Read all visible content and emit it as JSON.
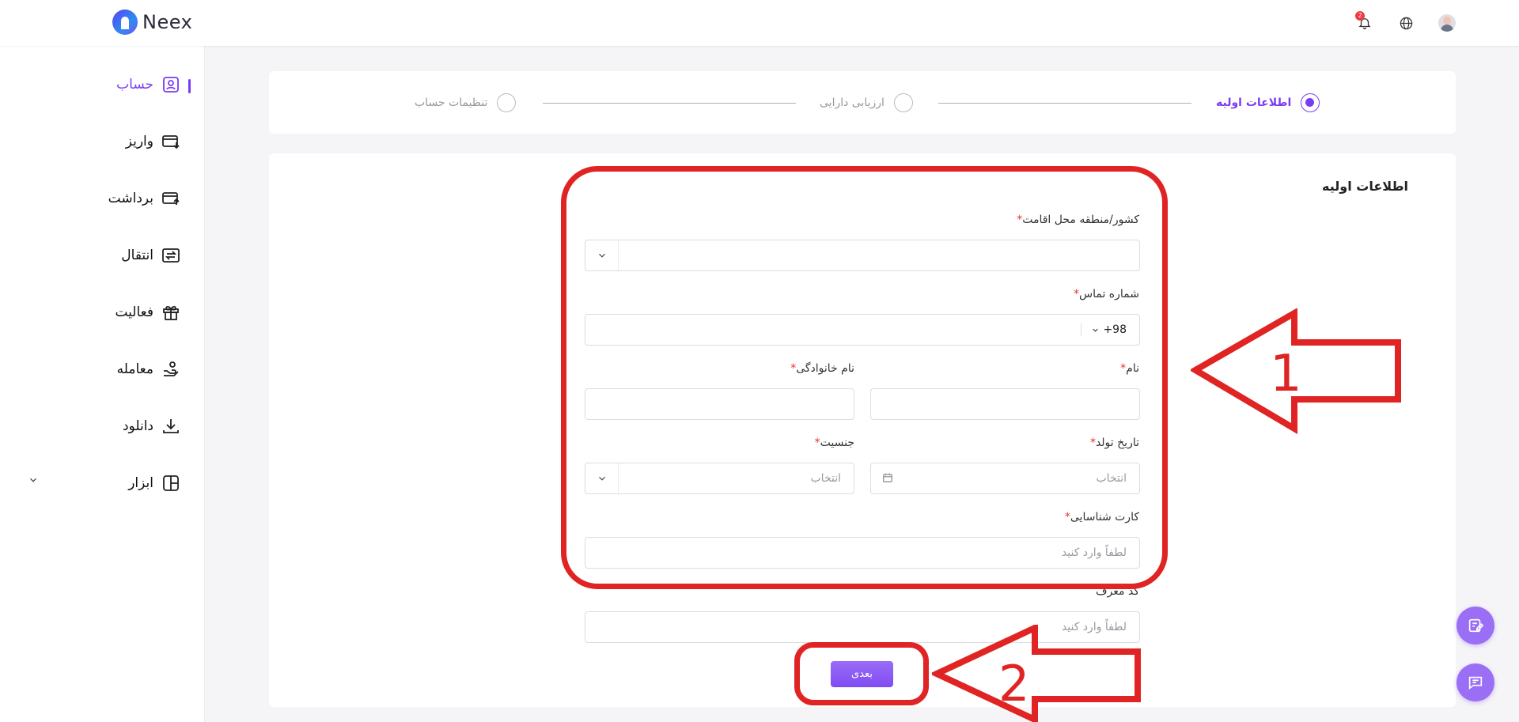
{
  "header": {
    "brand": "Neex",
    "notification_count": "2"
  },
  "sidebar": {
    "items": [
      {
        "label": "حساب",
        "icon": "user-square-icon",
        "active": true
      },
      {
        "label": "واریز",
        "icon": "card-deposit-icon",
        "active": false
      },
      {
        "label": "برداشت",
        "icon": "card-withdraw-icon",
        "active": false
      },
      {
        "label": "انتقال",
        "icon": "transfer-icon",
        "active": false
      },
      {
        "label": "فعالیت",
        "icon": "gift-icon",
        "active": false
      },
      {
        "label": "معامله",
        "icon": "trade-hand-icon",
        "active": false
      },
      {
        "label": "دانلود",
        "icon": "download-icon",
        "active": false
      },
      {
        "label": "ابزار",
        "icon": "layout-icon",
        "active": false
      }
    ]
  },
  "stepper": {
    "steps": [
      {
        "label": "اطلاعات اولیه",
        "active": true
      },
      {
        "label": "ارزیابی دارایی",
        "active": false
      },
      {
        "label": "تنظیمات حساب",
        "active": false
      }
    ]
  },
  "form": {
    "title": "اطلاعات اولیه",
    "country_label": "کشور/منطقه محل اقامت",
    "phone_label": "شماره تماس",
    "phone_code": "+98",
    "first_name_label": "نام",
    "last_name_label": "نام خانوادگی",
    "birth_label": "تاریخ تولد",
    "birth_placeholder": "انتخاب",
    "gender_label": "جنسیت",
    "gender_placeholder": "انتخاب",
    "id_card_label": "کارت شناسایی",
    "id_card_placeholder": "لطفاً وارد کنید",
    "referral_label": "کد معرف",
    "referral_placeholder": "لطفاً وارد کنید",
    "next_button": "بعدی"
  },
  "annotations": {
    "arrow1": "1",
    "arrow2": "2"
  },
  "colors": {
    "accent": "#7a3cf2",
    "annotation": "#e02424",
    "required": "#e5342b"
  }
}
